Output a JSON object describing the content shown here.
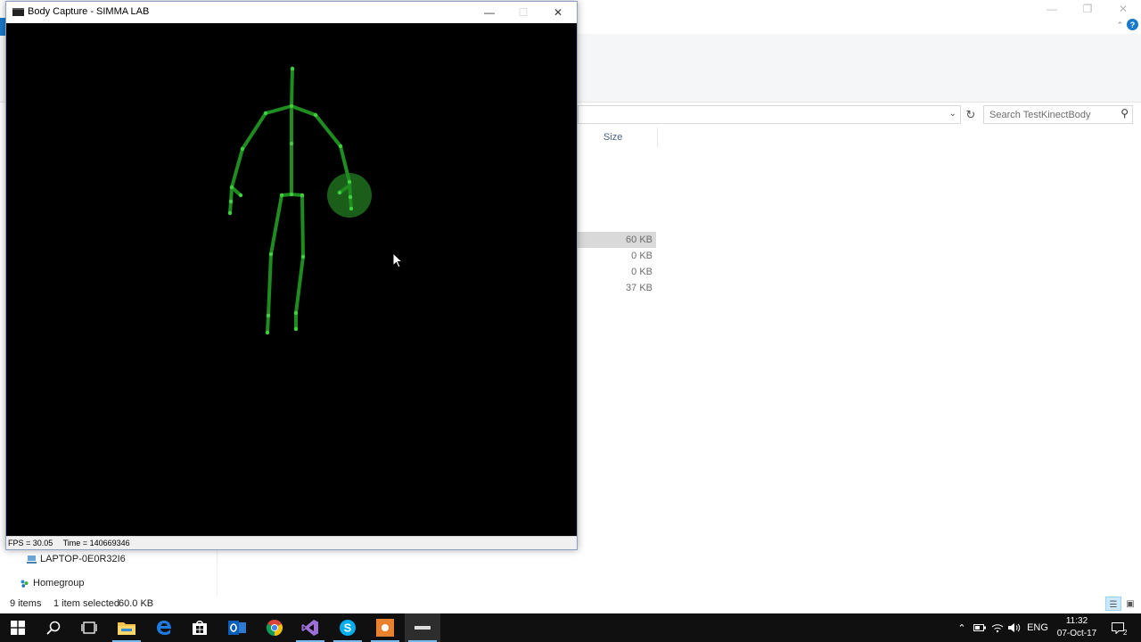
{
  "capture_window": {
    "title": "Body Capture - SIMMA LAB",
    "status": {
      "fps": "FPS = 30.05",
      "time": "Time = 140669346"
    }
  },
  "explorer": {
    "search_placeholder": "Search TestKinectBody",
    "columns": {
      "size": "Size"
    },
    "files": [
      {
        "size": "60 KB",
        "selected": true
      },
      {
        "size": "0 KB",
        "selected": false
      },
      {
        "size": "0 KB",
        "selected": false
      },
      {
        "size": "37 KB",
        "selected": false
      }
    ],
    "nav": {
      "laptop": "LAPTOP-0E0R32I6",
      "homegroup": "Homegroup"
    },
    "statusbar": {
      "items": "9 items",
      "selected": "1 item selected",
      "selected_size": "60.0 KB"
    }
  },
  "taskbar": {
    "apps": [
      "start-icon",
      "search-icon",
      "task-view-icon",
      "file-explorer-icon",
      "edge-icon",
      "store-icon",
      "outlook-icon",
      "chrome-icon",
      "visual-studio-icon",
      "skype-icon",
      "orange-app-icon",
      "body-capture-icon"
    ],
    "language": "ENG",
    "time": "11:32",
    "date": "07-Oct-17",
    "notification_count": "2"
  },
  "colors": {
    "skeleton_bone": "#1e8c1e",
    "skeleton_joint": "#3fcf3f",
    "hand_state": "#1e6e1e",
    "viewport_bg": "#000000",
    "accent": "#1979ca"
  }
}
